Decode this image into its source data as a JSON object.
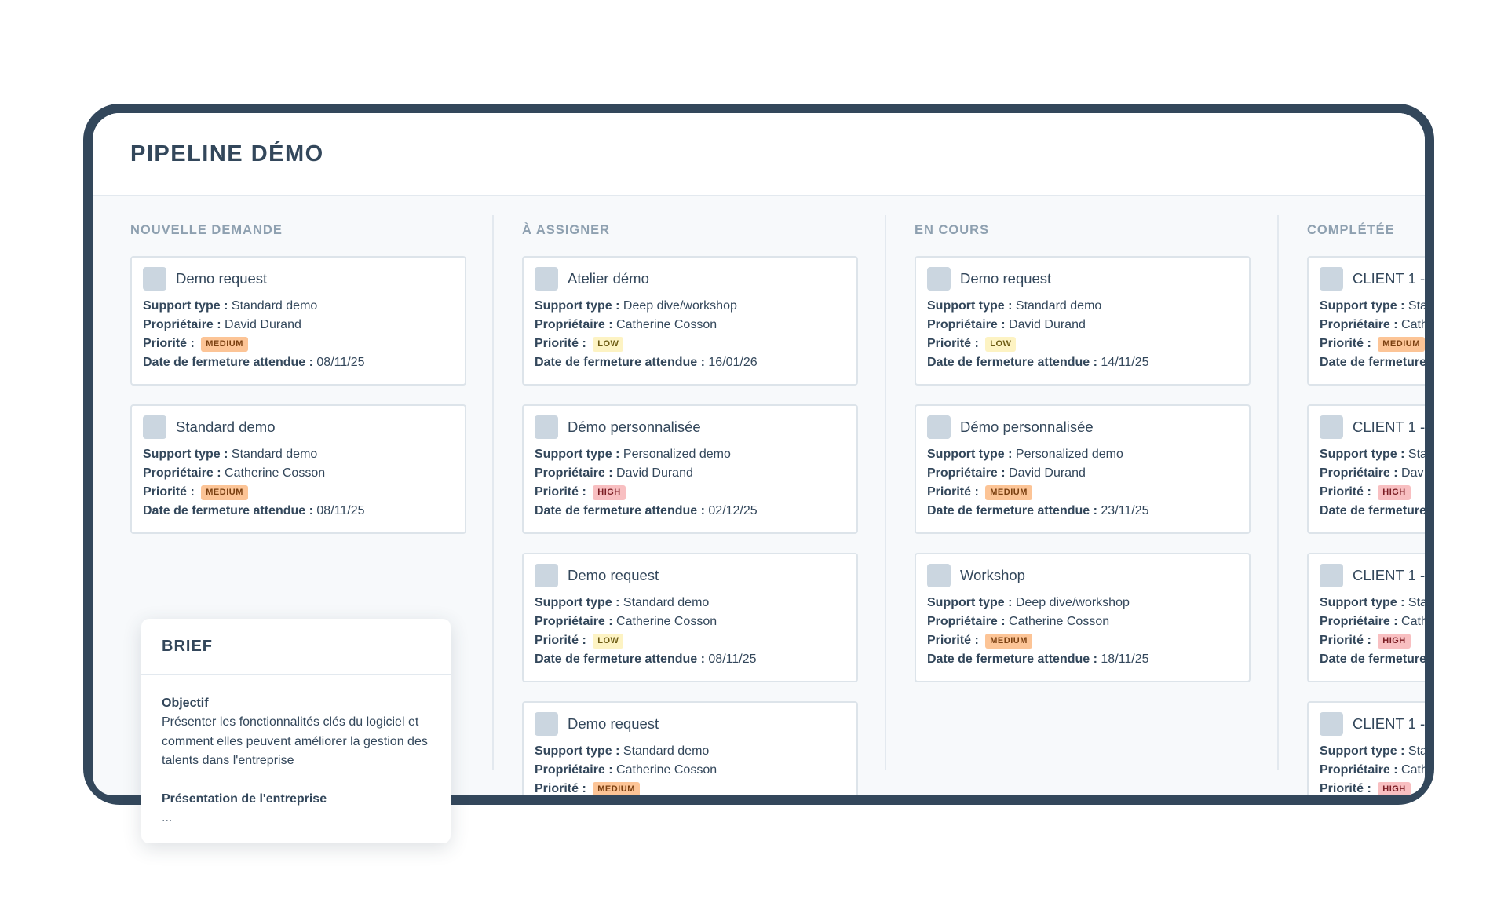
{
  "page_title": "PIPELINE DÉMO",
  "labels": {
    "support_type": "Support type :",
    "owner": "Propriétaire :",
    "priority": "Priorité :",
    "close_date": "Date de fermeture attendue :"
  },
  "columns": [
    {
      "title": "NOUVELLE DEMANDE",
      "cards": [
        {
          "title": "Demo request",
          "support": "Standard demo",
          "owner": "David Durand",
          "priority": "MEDIUM",
          "date": "08/11/25"
        },
        {
          "title": "Standard demo",
          "support": "Standard demo",
          "owner": "Catherine Cosson",
          "priority": "MEDIUM",
          "date": "08/11/25"
        }
      ]
    },
    {
      "title": "À ASSIGNER",
      "cards": [
        {
          "title": "Atelier démo",
          "support": "Deep dive/workshop",
          "owner": "Catherine Cosson",
          "priority": "LOW",
          "date": "16/01/26"
        },
        {
          "title": "Démo personnalisée",
          "support": "Personalized demo",
          "owner": "David Durand",
          "priority": "HIGH",
          "date": "02/12/25"
        },
        {
          "title": "Demo request",
          "support": "Standard demo",
          "owner": "Catherine Cosson",
          "priority": "LOW",
          "date": "08/11/25"
        },
        {
          "title": "Demo request",
          "support": "Standard demo",
          "owner": "Catherine Cosson",
          "priority": "MEDIUM",
          "date": ""
        }
      ]
    },
    {
      "title": "EN COURS",
      "cards": [
        {
          "title": "Demo request",
          "support": "Standard demo",
          "owner": "David Durand",
          "priority": "LOW",
          "date": "14/11/25"
        },
        {
          "title": "Démo personnalisée",
          "support": "Personalized demo",
          "owner": "David Durand",
          "priority": "MEDIUM",
          "date": "23/11/25"
        },
        {
          "title": "Workshop",
          "support": "Deep dive/workshop",
          "owner": "Catherine Cosson",
          "priority": "MEDIUM",
          "date": "18/11/25"
        }
      ]
    },
    {
      "title": "COMPLÉTÉE",
      "cards": [
        {
          "title": "CLIENT 1 -",
          "support": "Sta",
          "owner": "Cath",
          "priority": "MEDIUM",
          "date": ""
        },
        {
          "title": "CLIENT 1 -",
          "support": "Sta",
          "owner": "Dav",
          "priority": "HIGH",
          "date": ""
        },
        {
          "title": "CLIENT 1 -",
          "support": "Sta",
          "owner": "Cath",
          "priority": "HIGH",
          "date": ""
        },
        {
          "title": "CLIENT 1 -",
          "support": "Sta",
          "owner": "Cath",
          "priority": "HIGH",
          "date": ""
        }
      ]
    }
  ],
  "brief": {
    "title": "BRIEF",
    "objective_label": "Objectif",
    "objective_text": "Présenter les fonctionnalités clés du logiciel et comment elles peuvent améliorer la gestion des talents dans l'entreprise",
    "company_label": "Présentation de l'entreprise",
    "company_text": "..."
  },
  "colors": {
    "frame": "#33475b",
    "medium": "#fcc496",
    "low": "#fdf3c3",
    "high": "#f8bfc1"
  }
}
